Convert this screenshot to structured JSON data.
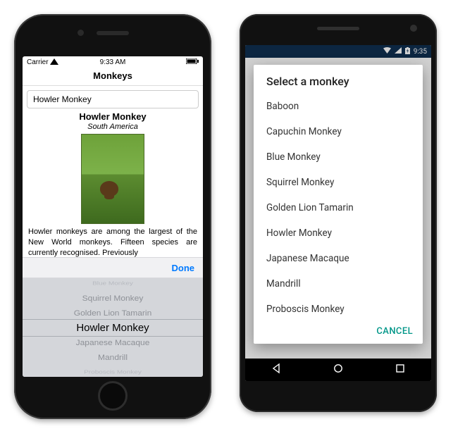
{
  "ios": {
    "status": {
      "carrier": "Carrier",
      "time": "9:33 AM"
    },
    "title": "Monkeys",
    "picker_value": "Howler Monkey",
    "detail": {
      "name": "Howler Monkey",
      "location": "South America",
      "description": "Howler monkeys are among the largest of the New World monkeys. Fifteen species are currently recognised. Previously"
    },
    "done_label": "Done",
    "wheel": [
      "Blue Monkey",
      "Squirrel Monkey",
      "Golden Lion Tamarin",
      "Howler Monkey",
      "Japanese Macaque",
      "Mandrill",
      "Proboscis Monkey"
    ],
    "wheel_selected_index": 3
  },
  "android": {
    "status": {
      "time": "9:35"
    },
    "dialog_title": "Select a monkey",
    "options": [
      "Baboon",
      "Capuchin Monkey",
      "Blue Monkey",
      "Squirrel Monkey",
      "Golden Lion Tamarin",
      "Howler Monkey",
      "Japanese Macaque",
      "Mandrill",
      "Proboscis Monkey"
    ],
    "cancel_label": "CANCEL"
  }
}
